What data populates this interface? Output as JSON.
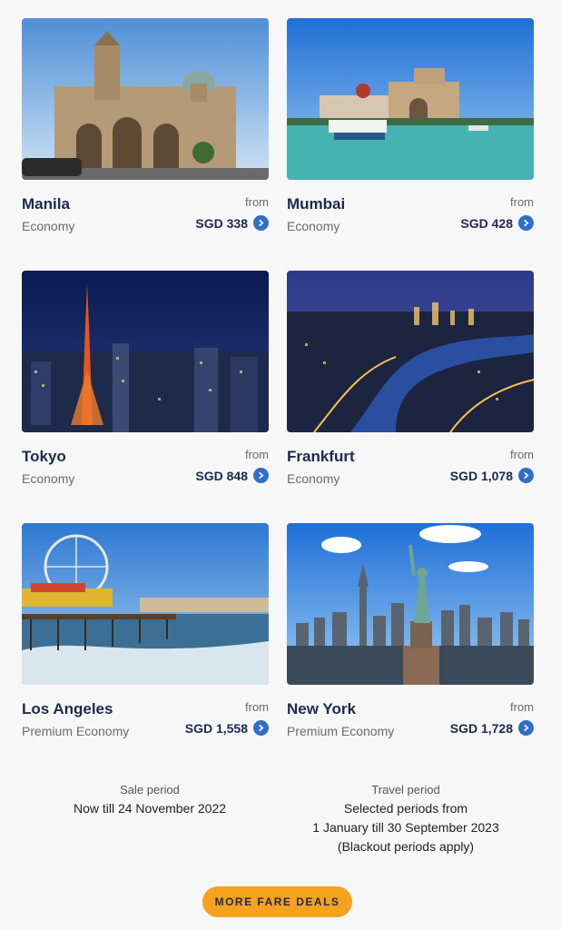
{
  "destinations": [
    {
      "city": "Manila",
      "cabin": "Economy",
      "from": "from",
      "price": "SGD 338"
    },
    {
      "city": "Mumbai",
      "cabin": "Economy",
      "from": "from",
      "price": "SGD 428"
    },
    {
      "city": "Tokyo",
      "cabin": "Economy",
      "from": "from",
      "price": "SGD 848"
    },
    {
      "city": "Frankfurt",
      "cabin": "Economy",
      "from": "from",
      "price": "SGD 1,078"
    },
    {
      "city": "Los Angeles",
      "cabin": "Premium Economy",
      "from": "from",
      "price": "SGD 1,558"
    },
    {
      "city": "New York",
      "cabin": "Premium Economy",
      "from": "from",
      "price": "SGD 1,728"
    }
  ],
  "sale_period": {
    "label": "Sale period",
    "text": "Now till 24 November 2022"
  },
  "travel_period": {
    "label": "Travel period",
    "line1": "Selected periods from",
    "line2": "1 January till 30 September 2023",
    "line3": "(Blackout periods apply)"
  },
  "cta": {
    "label": "MORE FARE DEALS"
  },
  "colors": {
    "accent": "#f6a21e",
    "link": "#2f6fc9",
    "text": "#1d2a4f"
  },
  "icons": {
    "price_link": "chevron-right-icon"
  }
}
